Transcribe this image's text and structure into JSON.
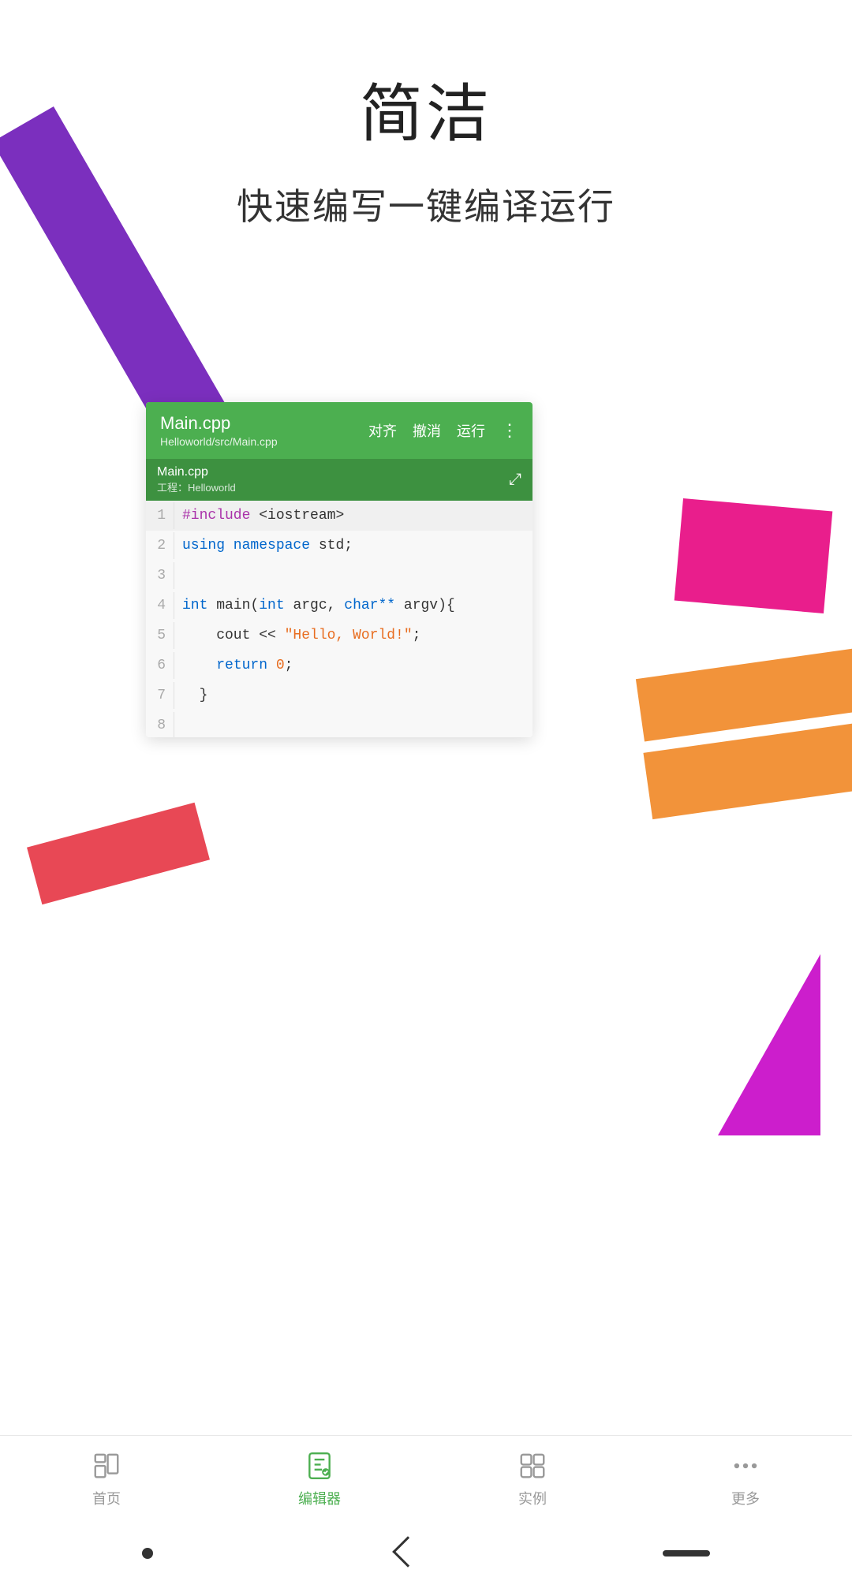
{
  "page": {
    "title": "简洁",
    "subtitle": "快速编写一键编译运行"
  },
  "editor": {
    "filename": "Main.cpp",
    "filepath": "Helloworld/src/Main.cpp",
    "tab_name": "Main.cpp",
    "tab_project": "工程：Helloworld",
    "toolbar_actions": {
      "align": "对齐",
      "undo": "撤消",
      "run": "运行"
    }
  },
  "code_lines": [
    {
      "num": "1",
      "content": "#include <iostream>"
    },
    {
      "num": "2",
      "content": "using namespace std;"
    },
    {
      "num": "3",
      "content": ""
    },
    {
      "num": "4",
      "content": "int main(int argc, char** argv){"
    },
    {
      "num": "5",
      "content": "    cout << \"Hello, World!\";"
    },
    {
      "num": "6",
      "content": "    return 0;"
    },
    {
      "num": "7",
      "content": "  }"
    },
    {
      "num": "8",
      "content": ""
    }
  ],
  "nav": {
    "items": [
      {
        "id": "home",
        "label": "首页",
        "active": false
      },
      {
        "id": "editor",
        "label": "编辑器",
        "active": true
      },
      {
        "id": "examples",
        "label": "实例",
        "active": false
      },
      {
        "id": "more",
        "label": "更多",
        "active": false
      }
    ]
  }
}
